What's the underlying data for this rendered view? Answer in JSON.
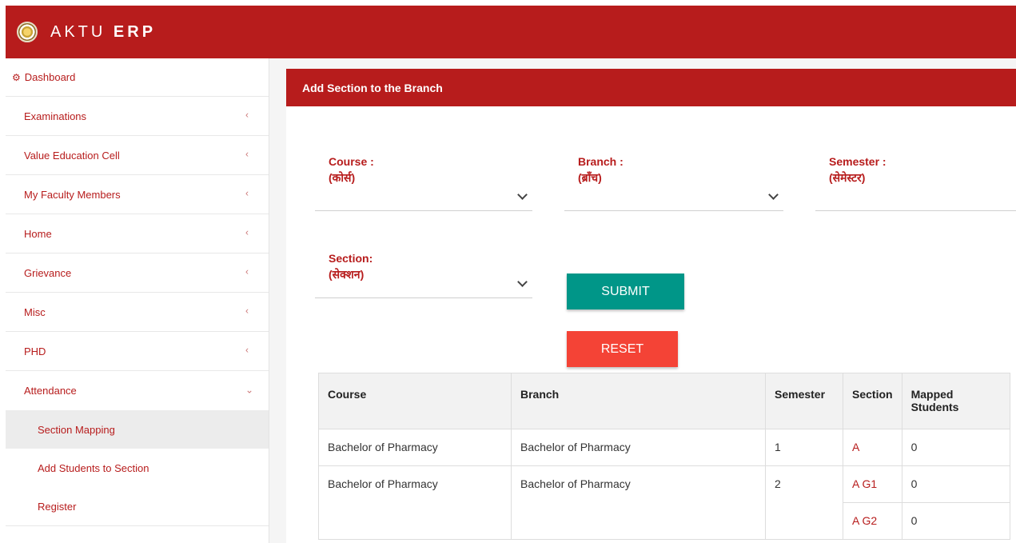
{
  "app": {
    "brand_light": "AKTU",
    "brand_bold": "ERP"
  },
  "sidebar": {
    "dashboard": "Dashboard",
    "items": [
      {
        "label": "Examinations",
        "chevron": "‹"
      },
      {
        "label": "Value Education Cell",
        "chevron": "‹"
      },
      {
        "label": "My Faculty Members",
        "chevron": "‹"
      },
      {
        "label": "Home",
        "chevron": "‹"
      },
      {
        "label": "Grievance",
        "chevron": "‹"
      },
      {
        "label": "Misc",
        "chevron": "‹"
      },
      {
        "label": "PHD",
        "chevron": "‹"
      },
      {
        "label": "Attendance",
        "chevron": "⌄"
      }
    ],
    "subitems": [
      {
        "label": "Section Mapping",
        "active": true
      },
      {
        "label": "Add Students to Section",
        "active": false
      },
      {
        "label": "Register",
        "active": false
      }
    ]
  },
  "card": {
    "title": "Add Section to the Branch"
  },
  "form": {
    "course_label": "Course :",
    "course_label_hi": "(कोर्स)",
    "branch_label": "Branch :",
    "branch_label_hi": "(ब्राँच)",
    "semester_label": "Semester :",
    "semester_label_hi": "(सेमेस्टर)",
    "section_label": "Section:",
    "section_label_hi": "(सेक्शन)",
    "submit": "SUBMIT",
    "reset": "RESET"
  },
  "table": {
    "headers": [
      "Course",
      "Branch",
      "Semester",
      "Section",
      "Mapped",
      "Students"
    ],
    "rows": [
      {
        "course": "Bachelor of Pharmacy",
        "branch": "Bachelor of Pharmacy",
        "semester": "1",
        "section": "A",
        "mapped": "0"
      },
      {
        "course": "Bachelor of Pharmacy",
        "branch": "Bachelor of Pharmacy",
        "semester": "2",
        "section": "A G1",
        "mapped": "0"
      },
      {
        "section": "A G2",
        "mapped": "0"
      }
    ]
  },
  "colors": {
    "brand": "#b71c1c",
    "submit": "#009688",
    "reset": "#f44336"
  }
}
